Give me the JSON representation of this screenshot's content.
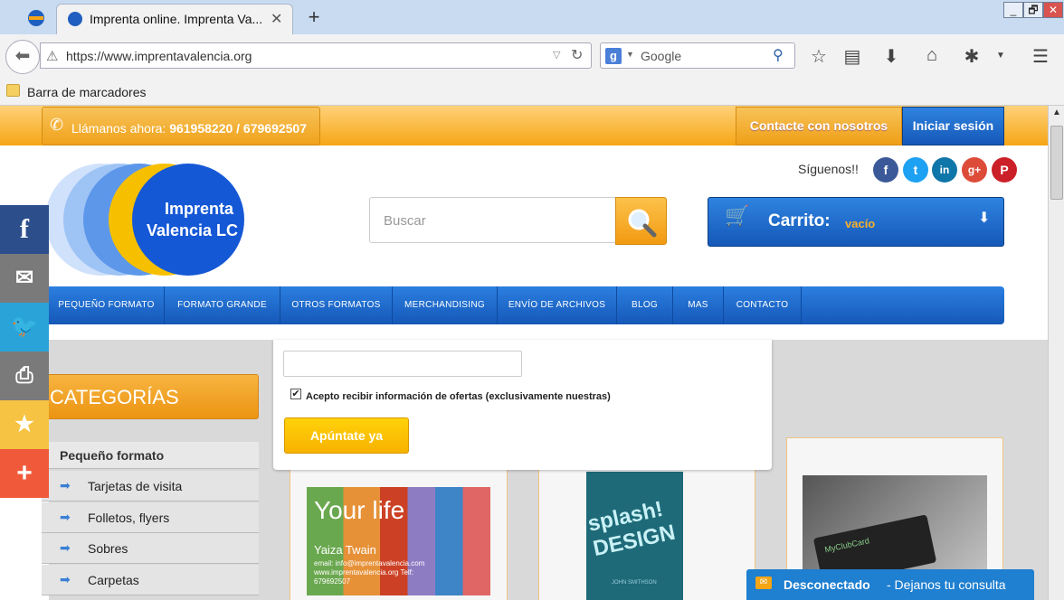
{
  "browser": {
    "tab_title": "Imprenta online. Imprenta Va...",
    "tab_close": "✕",
    "new_tab": "+",
    "url": "https://www.imprentavalencia.org",
    "search_engine": "Google",
    "bookmarks_toolbar": "Barra de marcadores",
    "window_buttons": [
      "_",
      "🗗",
      "✕"
    ]
  },
  "header": {
    "call_label": "Llámanos ahora:",
    "phones": "961958220 / 679692507",
    "contact_button": "Contacte con nosotros",
    "login_button": "Iniciar sesión",
    "follow_label": "Síguenos!!",
    "social": [
      "f",
      "t",
      "in",
      "g+",
      "P"
    ],
    "logo_line1": "Imprenta",
    "logo_line2": "Valencia LC",
    "search_placeholder": "Buscar",
    "cart_label": "Carrito:",
    "cart_state": "vacío"
  },
  "menu": [
    "PEQUEÑO FORMATO",
    "FORMATO GRANDE",
    "OTROS FORMATOS",
    "MERCHANDISING",
    "ENVÍO DE ARCHIVOS",
    "BLOG",
    "MAS",
    "CONTACTO"
  ],
  "share": {
    "colors": [
      "#2c4f8c",
      "#7a7a7a",
      "#2aa3d8",
      "#7a7a7a",
      "#f6c342",
      "#f05a3a"
    ]
  },
  "categories": {
    "title": "CATEGORÍAS",
    "group": "Pequeño formato",
    "items": [
      "Tarjetas de visita",
      "Folletos, flyers",
      "Sobres",
      "Carpetas"
    ]
  },
  "newsletter": {
    "checkbox_label": "Acepto recibir información de ofertas (exclusivamente nuestras)",
    "submit": "Apúntate ya"
  },
  "products": {
    "card1_title": "Your life",
    "card1_name": "Yaiza Twain",
    "card1_lines": "email: info@imprentavalencia.com www.imprentavalencia.org Telf: 679692507",
    "card2_title": "splash! DESIGN",
    "card2_name": "JOHN SMITHSON",
    "card3_title": "MyClubCard"
  },
  "chat": {
    "status": "Desconectado",
    "message": "- Dejanos tu consulta"
  }
}
